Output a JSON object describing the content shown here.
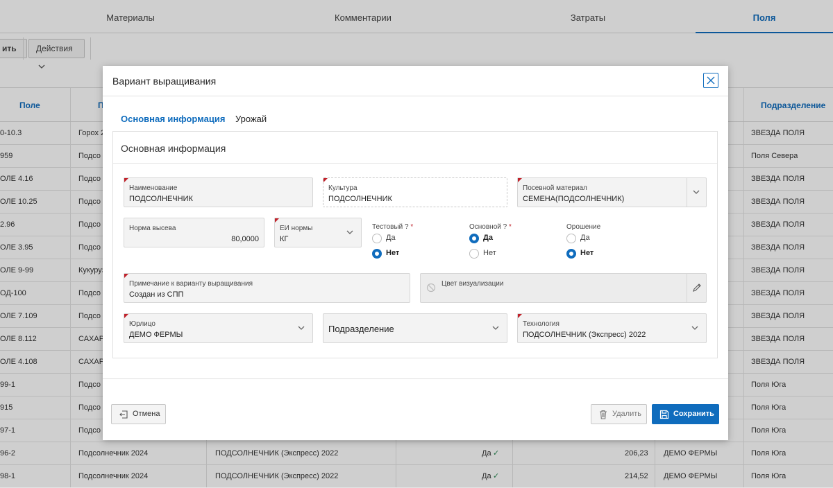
{
  "top_tabs": [
    {
      "label": "Материалы"
    },
    {
      "label": "Комментарии"
    },
    {
      "label": "Затраты"
    },
    {
      "label": "Поля"
    }
  ],
  "toolbar": {
    "add_label_fragment": "ить",
    "actions_label": "Действия"
  },
  "grid": {
    "headers": {
      "field": "Поле",
      "name_fragment": "П",
      "division": "Подразделение"
    },
    "rows": [
      {
        "field": "0-10.3",
        "name": "Горох 2",
        "division": "ЗВЕЗДА ПОЛЯ"
      },
      {
        "field": "959",
        "name": "Подсо",
        "division": "Поля Севера"
      },
      {
        "field": "ОЛЕ 4.16",
        "name": "Подсо",
        "division": "ЗВЕЗДА ПОЛЯ"
      },
      {
        "field": "ОЛЕ 10.25",
        "name": "Подсо",
        "division": "ЗВЕЗДА ПОЛЯ"
      },
      {
        "field": "2.96",
        "name": "Подсо",
        "division": "ЗВЕЗДА ПОЛЯ"
      },
      {
        "field": "ОЛЕ 3.95",
        "name": "Подсо",
        "division": "ЗВЕЗДА ПОЛЯ"
      },
      {
        "field": "ОЛЕ 9-99",
        "name": "Кукуруз",
        "division": "ЗВЕЗДА ПОЛЯ"
      },
      {
        "field": "ОД-100",
        "name": "Подсо",
        "division": "ЗВЕЗДА ПОЛЯ"
      },
      {
        "field": "ОЛЕ 7.109",
        "name": "Подсо",
        "division": "ЗВЕЗДА ПОЛЯ"
      },
      {
        "field": "ОЛЕ 8.112",
        "name": "САХАР",
        "division": "ЗВЕЗДА ПОЛЯ"
      },
      {
        "field": "ОЛЕ 4.108",
        "name": "САХАР",
        "division": "ЗВЕЗДА ПОЛЯ"
      },
      {
        "field": "99-1",
        "name": "Подсо",
        "division": "Поля Юга"
      },
      {
        "field": "915",
        "name": "Подсо",
        "division": "Поля Юга"
      },
      {
        "field": "97-1",
        "name": "Подсо",
        "division": "Поля Юга"
      },
      {
        "field": "96-2",
        "name": "Подсолнечник 2024",
        "tech": "ПОДСОЛНЕЧНИК (Экспресс) 2022",
        "flag": "Да",
        "value": "206,23",
        "org": "ДЕМО ФЕРМЫ",
        "division": "Поля Юга"
      },
      {
        "field": "98-1",
        "name": "Подсолнечник 2024",
        "tech": "ПОДСОЛНЕЧНИК (Экспресс) 2022",
        "flag": "Да",
        "value": "214,52",
        "org": "ДЕМО ФЕРМЫ",
        "division": "Поля Юга"
      }
    ]
  },
  "modal": {
    "title": "Вариант выращивания",
    "tabs": [
      {
        "label": "Основная информация"
      },
      {
        "label": "Урожай"
      }
    ],
    "section_title": "Основная информация",
    "fields": {
      "name": {
        "label": "Наименование",
        "value": "ПОДСОЛНЕЧНИК"
      },
      "culture": {
        "label": "Культура",
        "value": "ПОДСОЛНЕЧНИК"
      },
      "seed": {
        "label": "Посевной материал",
        "value": "СЕМЕНА(ПОДСОЛНЕЧНИК)"
      },
      "rate": {
        "label": "Норма высева",
        "value": "80,0000"
      },
      "unit": {
        "label": "ЕИ нормы",
        "value": "КГ"
      },
      "note": {
        "label": "Примечание к варианту выращивания",
        "value": "Создан из СПП"
      },
      "color": {
        "label": "Цвет визуализации",
        "value": ""
      },
      "legal": {
        "label": "Юрлицо",
        "value": "ДЕМО ФЕРМЫ"
      },
      "division": {
        "placeholder": "Подразделение"
      },
      "tech": {
        "label": "Технология",
        "value": "ПОДСОЛНЕЧНИК (Экспресс) 2022"
      }
    },
    "radios": {
      "test": {
        "label": "Тестовый ?",
        "yes": "Да",
        "no": "Нет",
        "selected": "no"
      },
      "main": {
        "label": "Основной ?",
        "yes": "Да",
        "no": "Нет",
        "selected": "yes"
      },
      "irrigation": {
        "label": "Орошение",
        "yes": "Да",
        "no": "Нет",
        "selected": "no"
      }
    },
    "required_mark": "*",
    "buttons": {
      "cancel": "Отмена",
      "delete": "Удалить",
      "save": "Сохранить"
    }
  },
  "colors": {
    "accent": "#0f6cbd",
    "required": "#c0212a",
    "check": "#2e8b57"
  }
}
